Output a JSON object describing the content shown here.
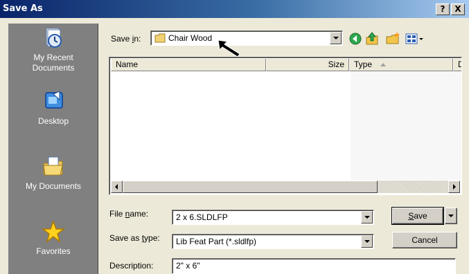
{
  "window": {
    "title": "Save As",
    "help_label": "?",
    "close_label": "X"
  },
  "places": [
    {
      "line1": "My Recent",
      "line2": "Documents",
      "icon": "recent-documents-icon"
    },
    {
      "line1": "Desktop",
      "line2": "",
      "icon": "desktop-icon"
    },
    {
      "line1": "My Documents",
      "line2": "",
      "icon": "my-documents-icon"
    },
    {
      "line1": "Favorites",
      "line2": "",
      "icon": "favorites-icon"
    }
  ],
  "save_in": {
    "label_pre": "Save ",
    "label_key": "i",
    "label_post": "n:",
    "value": "Chair Wood"
  },
  "toolbar_icons": [
    "back-icon",
    "up-folder-icon",
    "new-folder-icon",
    "views-menu-icon"
  ],
  "columns": {
    "name": "Name",
    "size": "Size",
    "type": "Type",
    "extra": "D"
  },
  "file_name": {
    "label_pre": "File ",
    "label_key": "n",
    "label_post": "ame:",
    "value": "2 x 6.SLDLFP"
  },
  "save_as_type": {
    "label_pre": "Save as ",
    "label_key": "t",
    "label_post": "ype:",
    "value": "Lib Feat Part (*.sldlfp)"
  },
  "description": {
    "label": "Description:",
    "value": "2\" x 6\""
  },
  "buttons": {
    "save_key": "S",
    "save_rest": "ave",
    "cancel": "Cancel"
  }
}
